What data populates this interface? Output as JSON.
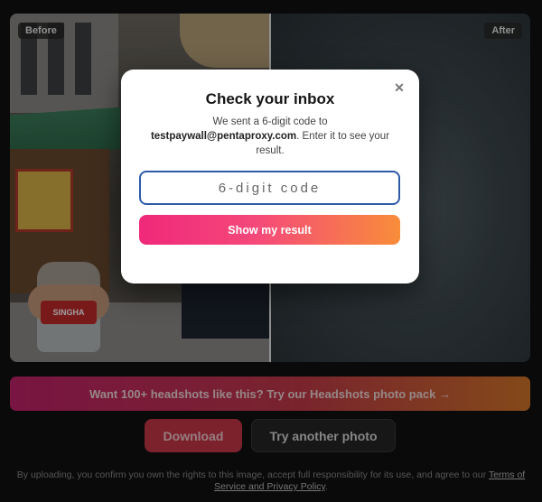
{
  "compare": {
    "before_label": "Before",
    "after_label": "After",
    "bottle_text": "SINGHA"
  },
  "promo": {
    "text": "Want 100+ headshots like this? Try our Headshots photo pack →"
  },
  "actions": {
    "download_label": "Download",
    "try_another_label": "Try another photo"
  },
  "disclaimer": {
    "text": "By uploading, you confirm you own the rights to this image, accept full responsibility for its use, and agree to our ",
    "link_label": "Terms of Service and Privacy Policy",
    "suffix": "."
  },
  "modal": {
    "title": "Check your inbox",
    "close_glyph": "✕",
    "desc_prefix": "We sent a 6-digit code to ",
    "email": "testpaywall@pentaproxy.com",
    "desc_suffix": ". Enter it to see your result.",
    "code_placeholder": "6-digit code",
    "code_value": "",
    "submit_label": "Show my result"
  },
  "colors": {
    "accent_pink": "#f0287a",
    "accent_orange": "#f88d3a",
    "input_border": "#2f5aa8"
  }
}
